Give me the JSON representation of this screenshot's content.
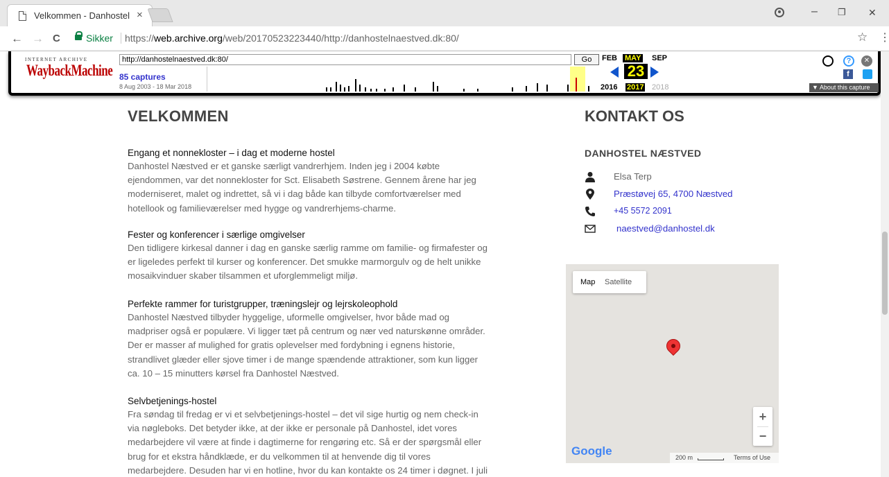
{
  "browser": {
    "tab_title": "Velkommen - Danhostel I",
    "tab_close": "×",
    "address": {
      "secure_label": "Sikker",
      "url_prefix": "https://",
      "url_host": "web.archive.org",
      "url_path": "/web/20170523223440/http://danhostelnaestved.dk:80/"
    },
    "win_min": "–",
    "win_restore": "❐",
    "win_close": "✕",
    "back": "←",
    "forward": "→",
    "reload": "C",
    "star": "☆",
    "menu": "⋮"
  },
  "wayback": {
    "logo_top": "INTERNET ARCHIVE",
    "logo": "WaybackMachine",
    "url_value": "http://danhostelnaestved.dk:80/",
    "go_label": "Go",
    "captures": "85 captures",
    "range": "8 Aug 2003 - 18 Mar 2018",
    "months": {
      "prev": "FEB",
      "cur": "MAY",
      "next": "SEP"
    },
    "day": "23",
    "years": {
      "prev": "2016",
      "cur": "2017",
      "next": "2018"
    },
    "about": "▼ About this capture"
  },
  "main": {
    "title": "VELKOMMEN",
    "sections": [
      {
        "heading": "Engang et nonnekloster – i dag et moderne hostel",
        "lines": [
          "Danhostel Næstved er et ganske særligt vandrerhjem. Inden jeg i 2004 købte",
          "ejendommen, var det nonnekloster for Sct. Elisabeth Søstrene. Gennem årene har jeg",
          "moderniseret, malet og indrettet, så vi i dag både kan tilbyde comfortværelser med",
          "hotellook og familieværelser med hygge og vandrerhjems-charme."
        ]
      },
      {
        "heading": "Fester og konferencer i særlige omgivelser",
        "lines": [
          "Den tidligere kirkesal danner i dag en ganske særlig ramme om familie- og firmafester og",
          "er ligeledes perfekt til kurser og konferencer. Det smukke marmorgulv og de helt unikke",
          "mosaikvinduer skaber tilsammen et uforglemmeligt miljø."
        ]
      },
      {
        "heading": "Perfekte rammer for turistgrupper, træningslejr og lejrskoleophold",
        "lines": [
          "Danhostel Næstved tilbyder hyggelige, uformelle omgivelser, hvor både mad og",
          "madpriser også er populære. Vi ligger tæt på centrum og nær ved naturskønne områder.",
          "Der er masser af mulighed for gratis oplevelser med fordybning i egnens historie,",
          "strandlivet glæder eller sjove timer i de mange spændende attraktioner, som kun ligger",
          "ca. 10 – 15 minutters kørsel fra Danhostel Næstved."
        ]
      },
      {
        "heading": "Selvbetjenings-hostel",
        "lines": [
          "Fra søndag til fredag er vi et selvbetjenings-hostel – det vil sige hurtig og nem check-in",
          "via nøgleboks. Det betyder ikke, at der ikke er personale på Danhostel, idet vores",
          "medarbejdere vil være at finde i dagtimerne for rengøring etc. Så er der spørgsmål eller",
          "brug for et ekstra håndklæde, er du velkommen til at henvende dig til vores",
          "medarbejdere. Desuden har vi en hotline, hvor du kan kontakte os 24 timer i døgnet. I juli"
        ]
      }
    ]
  },
  "sidebar": {
    "title": "KONTAKT OS",
    "subtitle": "DANHOSTEL NÆSTVED",
    "name": "Elsa Terp",
    "address": "Præstøvej 65, 4700 Næstved",
    "phone": "+45 5572 2091",
    "email": "naestved@danhostel.dk"
  },
  "map": {
    "tab_map": "Map",
    "tab_satellite": "Satellite",
    "zoom_in": "+",
    "zoom_out": "−",
    "scale": "200 m",
    "terms": "Terms of Use",
    "brand": "Google"
  },
  "colors": {
    "link": "#3333cc",
    "secure": "#0b8043",
    "wayback_red": "#bb0000",
    "pin": "#ee3333"
  }
}
